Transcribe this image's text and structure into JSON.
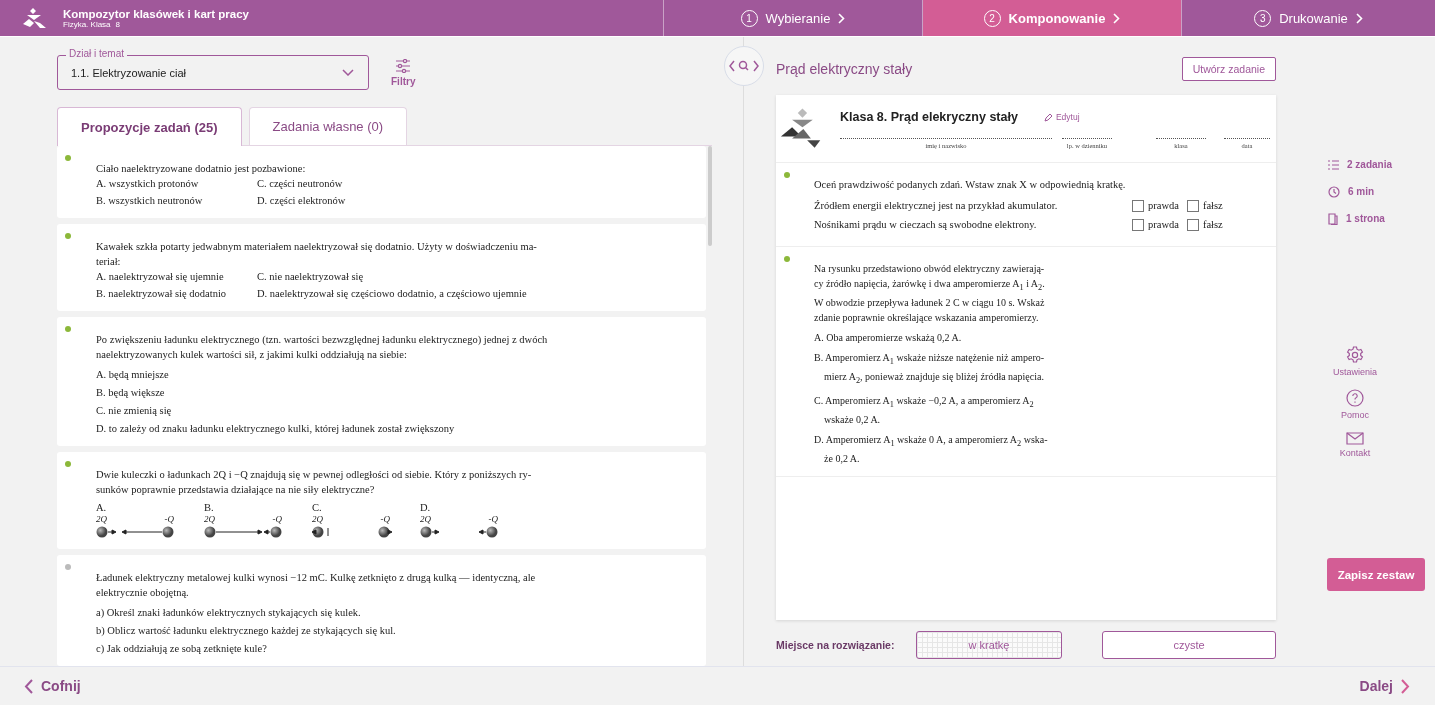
{
  "header": {
    "app_title": "Kompozytor klasówek i kart pracy",
    "subject": "Fizyka. Klasa",
    "grade": "8",
    "steps": [
      {
        "number": "1",
        "label": "Wybieranie",
        "selected": false
      },
      {
        "number": "2",
        "label": "Komponowanie",
        "selected": true
      },
      {
        "number": "3",
        "label": "Drukowanie",
        "selected": false
      }
    ]
  },
  "left": {
    "topic_select": {
      "label": "Dział i temat",
      "value": "1.1. Elektryzowanie ciał"
    },
    "filters_button": "Filtry",
    "tabs": [
      {
        "label": "Propozycje zadań (25)",
        "selected": true
      },
      {
        "label": "Zadania własne (0)",
        "selected": false
      }
    ],
    "tasks": [
      {
        "kind": "grid",
        "color": "#8cb83a",
        "text_lines": [
          "Ciało naelektryzowane dodatnio jest pozbawione:"
        ],
        "options": [
          "A. wszystkich protonów",
          "B. wszystkich neutronów",
          "C. części neutronów",
          "D. części elektronów"
        ]
      },
      {
        "kind": "grid",
        "color": "#8cb83a",
        "text_lines": [
          "Kawałek szkła potarty jedwabnym materiałem naelektryzował się dodatnio. Użyty w doświadczeniu ma-",
          "teriał:"
        ],
        "options": [
          "A. naelektryzował się ujemnie",
          "B. naelektryzował się dodatnio",
          "C. nie naelektryzował się",
          "D. naelektryzował się częściowo dodatnio, a częściowo ujemnie"
        ]
      },
      {
        "kind": "list",
        "color": "#8cb83a",
        "text_lines": [
          "Po zwiększeniu ładunku elektrycznego (tzn. wartości bezwzględnej ładunku elektrycznego) jednej z dwóch",
          "naelektryzowanych kulek wartości sił, z jakimi kulki oddziałują na siebie:"
        ],
        "options": [
          "A. będą mniejsze",
          "B. będą większe",
          "C. nie zmienią się",
          "D. to zależy od znaku ładunku elektrycznego kulki, której ładunek został zwiększony"
        ]
      },
      {
        "kind": "figure",
        "color": "#8cb83a",
        "text_lines": [
          "Dwie kuleczki o ładunkach 2Q i −Q znajdują się w pewnej odległości od siebie. Który z poniższych ry-",
          "sunków poprawnie przedstawia działające na nie siły elektryczne?"
        ],
        "options": [
          {
            "letter": "A.",
            "left_charge": "2Q",
            "right_charge": "-Q",
            "kind": "attract_long"
          },
          {
            "letter": "B.",
            "left_charge": "2Q",
            "right_charge": "-Q",
            "kind": "pushed_right"
          },
          {
            "letter": "C.",
            "left_charge": "2Q",
            "right_charge": "-Q",
            "kind": "repel"
          },
          {
            "letter": "D.",
            "left_charge": "2Q",
            "right_charge": "-Q",
            "kind": "attract"
          }
        ]
      },
      {
        "kind": "list",
        "color": "#bbbbbb",
        "text_lines": [
          "Ładunek elektryczny metalowej kulki wynosi −12 mC. Kulkę zetknięto z drugą kulką — identyczną, ale",
          "elektrycznie obojętną."
        ],
        "options": [
          "a)  Określ znaki ładunków elektrycznych stykających się kulek.",
          "b)  Oblicz wartość ładunku elektrycznego każdej ze stykających się kul.",
          "c)  Jak oddziałują ze sobą zetknięte kule?"
        ]
      }
    ]
  },
  "right": {
    "title": "Prąd elektryczny stały",
    "create_button": "Utwórz zadanie",
    "sheet": {
      "title": "Klasa 8. Prąd elekryczny stały",
      "edit_link": "Edytuj",
      "fields": [
        "imię i nazwisko",
        "lp. w dzienniku",
        "klasa",
        "data"
      ],
      "tasks": [
        {
          "kind": "true_false",
          "color": "#8cb83a",
          "text_lines": [
            "Oceń prawdziwość podanych zdań. Wstaw znak X w odpowiednią kratkę."
          ],
          "statements": [
            {
              "text": "Źródłem energii elektrycznej jest na przykład akumulator.",
              "options": [
                {
                  "label": "prawda",
                  "checked": false
                },
                {
                  "label": "fałsz",
                  "checked": false
                }
              ]
            },
            {
              "text": "Nośnikami prądu w cieczach są swobodne elektrony.",
              "options": [
                {
                  "label": "prawda",
                  "checked": false
                },
                {
                  "label": "fałsz",
                  "checked": false
                }
              ]
            }
          ]
        },
        {
          "kind": "choice",
          "color": "#8cb83a",
          "text_lines": [
            "Na rysunku przedstawiono obwód elektryczny zawierają-",
            "cy źródło napięcia, żarówkę i dwa amperomierze A$_{1}$ i A$_{2}$.",
            "W obwodzie przepływa ładunek 2 C w ciągu 10 s. Wskaż",
            "zdanie poprawnie określające wskazania amperomierzy."
          ],
          "options": [
            [
              "A. Oba amperomierze wskażą 0,2 A."
            ],
            [
              "B. Amperomierz A$_{1}$ wskaże niższe natężenie niż ampero-",
              "mierz A$_{2}$, ponieważ znajduje się bliżej źródła napięcia."
            ],
            [
              "C. Amperomierz A$_{1}$ wskaże −0,2 A, a amperomierz A$_{2}$",
              "wskaże 0,2 A."
            ],
            [
              "D. Amperomierz A$_{1}$ wskaże 0 A, a amperomierz A$_{2}$ wska-",
              "że 0,2 A."
            ]
          ]
        }
      ]
    },
    "solution_space": {
      "label": "Miejsce na rozwiązanie:",
      "options": [
        {
          "label": "w kratkę",
          "kind": "grid"
        },
        {
          "label": "czyste",
          "kind": "plain"
        }
      ]
    }
  },
  "sidebar": {
    "stats": [
      {
        "kind": "list",
        "label": "2 zadania"
      },
      {
        "kind": "clock",
        "label": "6 min"
      },
      {
        "kind": "page",
        "label": "1 strona"
      }
    ],
    "tools": [
      {
        "kind": "gear",
        "label": "Ustawienia"
      },
      {
        "kind": "help",
        "label": "Pomoc"
      },
      {
        "kind": "mail",
        "label": "Kontakt"
      }
    ],
    "save_button": "Zapisz zestaw"
  },
  "footer": {
    "back": "Cofnij",
    "next": "Dalej"
  }
}
